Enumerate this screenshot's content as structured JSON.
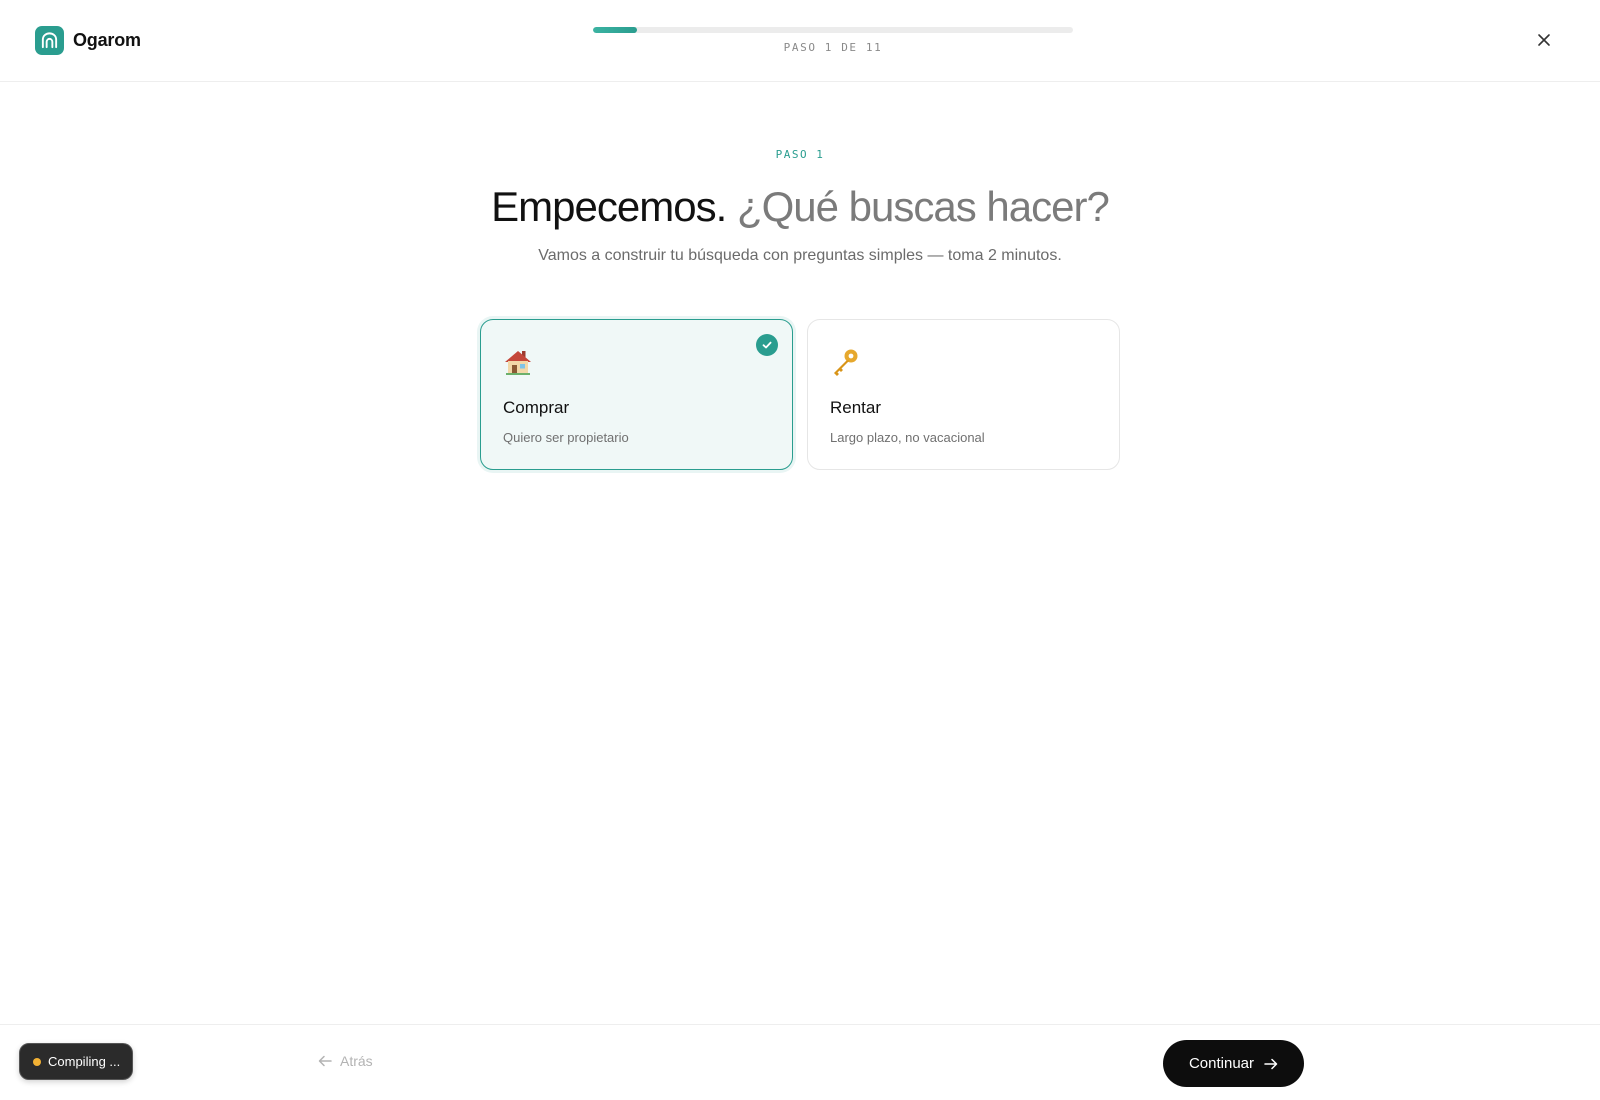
{
  "brand": {
    "name": "Ogarom",
    "accent_color": "#2a9d8f"
  },
  "progress": {
    "label": "PASO 1 DE 11",
    "current": 1,
    "total": 11
  },
  "step": {
    "eyebrow": "PASO 1",
    "title_strong": "Empecemos.",
    "title_soft": "¿Qué buscas hacer?",
    "subtitle": "Vamos a construir tu búsqueda con preguntas simples — toma 2 minutos."
  },
  "options": [
    {
      "id": "comprar",
      "emoji": "🏠",
      "icon": "house-icon",
      "title": "Comprar",
      "description": "Quiero ser propietario",
      "selected": true
    },
    {
      "id": "rentar",
      "emoji": "🔑",
      "icon": "key-icon",
      "title": "Rentar",
      "description": "Largo plazo, no vacacional",
      "selected": false
    }
  ],
  "footer": {
    "back_label": "Atrás",
    "continue_label": "Continuar",
    "status_label": "Compiling ..."
  }
}
